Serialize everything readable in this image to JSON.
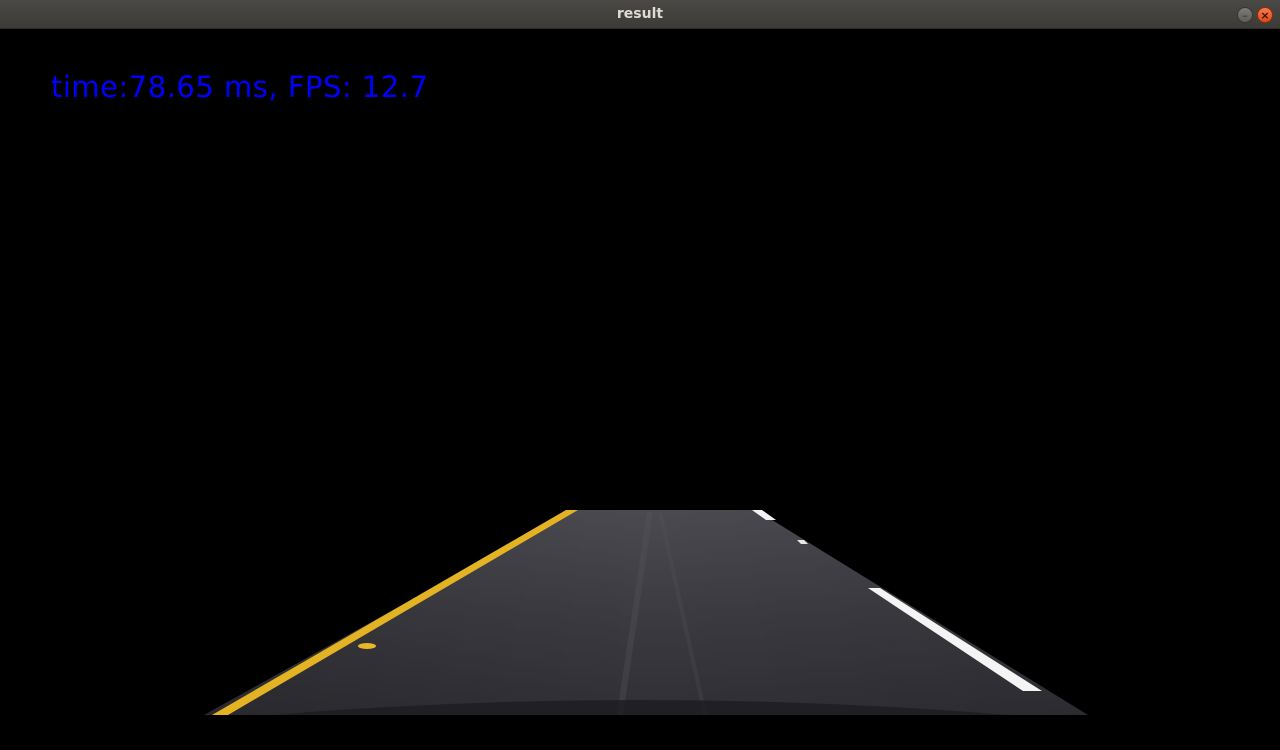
{
  "window": {
    "title": "result"
  },
  "controls": {
    "minimize_icon": "minimize-icon",
    "close_icon": "close-icon",
    "minimize_glyph": "–",
    "close_glyph": "×"
  },
  "overlay": {
    "timing_text": "time:78.65 ms, FPS: 12.7",
    "color": "#0000ff"
  }
}
